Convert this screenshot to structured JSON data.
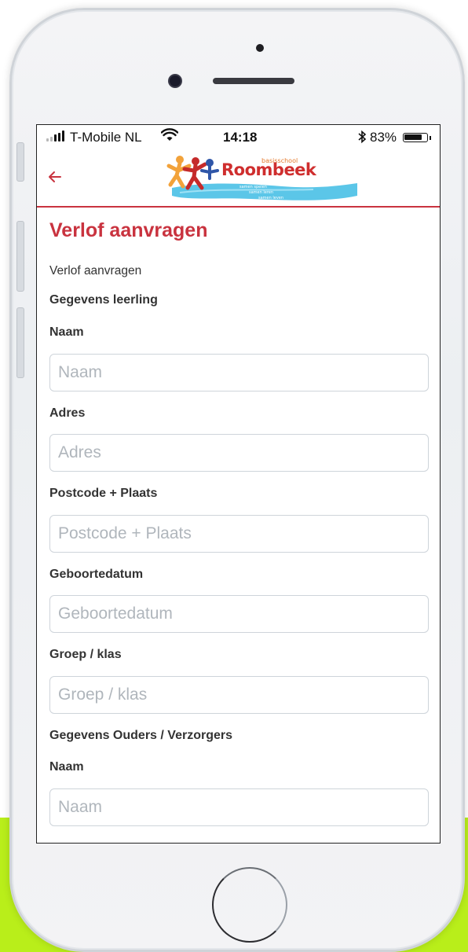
{
  "status_bar": {
    "carrier": "T-Mobile NL",
    "time": "14:18",
    "battery": "83%",
    "battery_level": 0.83,
    "icons": [
      "signal-icon",
      "wifi-icon",
      "bluetooth-icon",
      "battery-icon"
    ]
  },
  "app_bar": {
    "back_icon": "arrow-left-icon",
    "logo": {
      "small_text": "basisschool",
      "name": "Roombeek",
      "tagline": [
        "samen spelen",
        "samen leren",
        "samen leven"
      ]
    }
  },
  "page": {
    "title": "Verlof aanvragen",
    "subtitle": "Verlof aanvragen",
    "section_student": "Gegevens leerling",
    "section_parents": "Gegevens Ouders / Verzorgers"
  },
  "student_fields": [
    {
      "label": "Naam",
      "placeholder": "Naam"
    },
    {
      "label": "Adres",
      "placeholder": "Adres"
    },
    {
      "label": "Postcode + Plaats",
      "placeholder": "Postcode + Plaats"
    },
    {
      "label": "Geboortedatum",
      "placeholder": "Geboortedatum"
    },
    {
      "label": "Groep / klas",
      "placeholder": "Groep / klas"
    }
  ],
  "parent_fields": [
    {
      "label": "Naam",
      "placeholder": "Naam"
    }
  ],
  "colors": {
    "accent": "#c9333f",
    "background_lime": "#b9ee1a",
    "input_border": "#ced4da"
  }
}
